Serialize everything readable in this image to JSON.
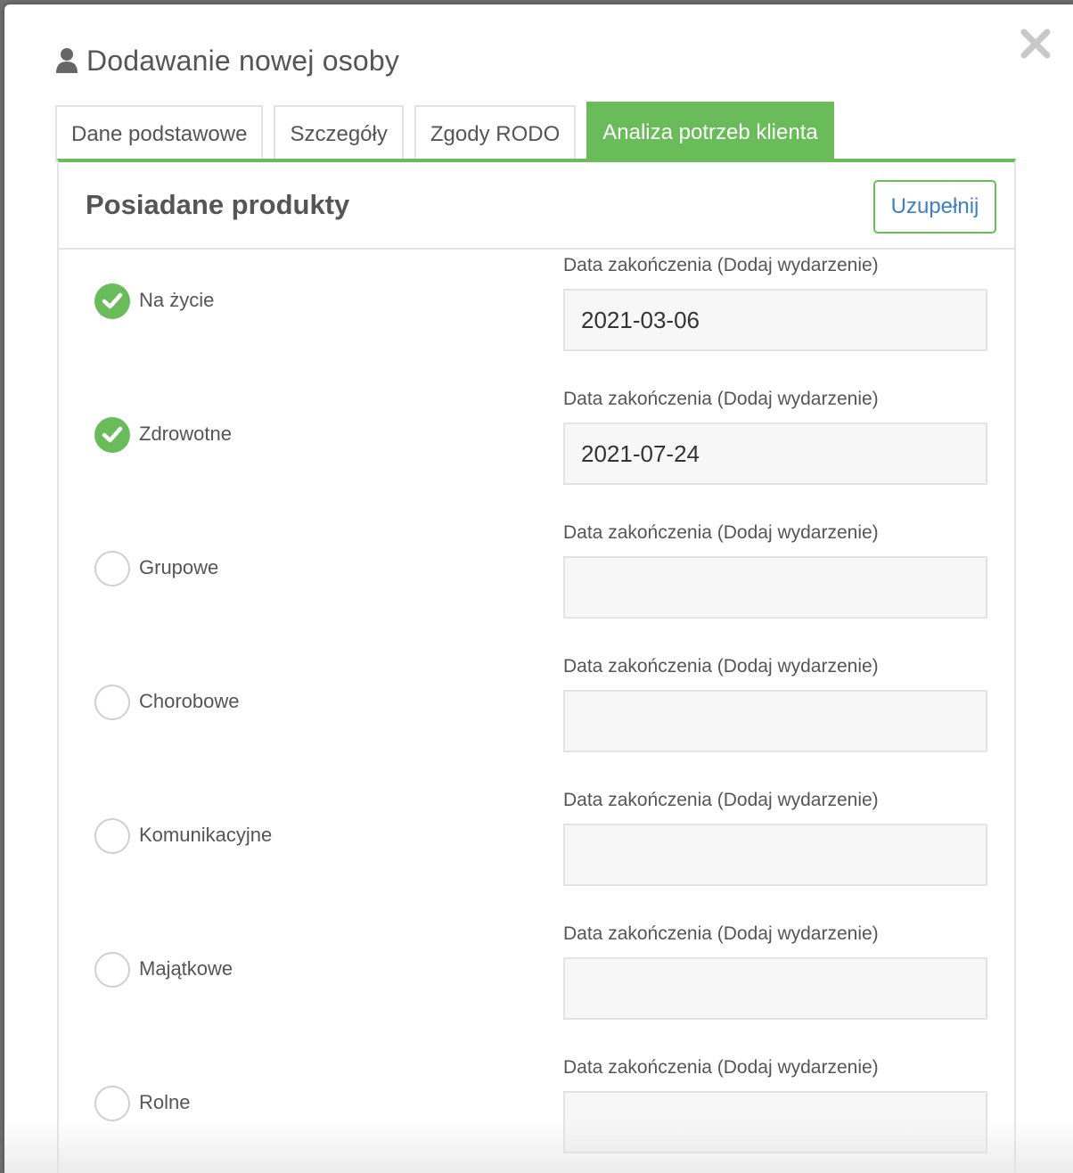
{
  "modal": {
    "title": "Dodawanie nowej osoby",
    "title_icon": "user-icon",
    "close_icon": "close-icon"
  },
  "tabs": [
    {
      "label": "Dane podstawowe",
      "active": false
    },
    {
      "label": "Szczegóły",
      "active": false
    },
    {
      "label": "Zgody RODO",
      "active": false
    },
    {
      "label": "Analiza potrzeb klienta",
      "active": true
    }
  ],
  "panel": {
    "title": "Posiadane produkty",
    "fill_button": "Uzupełnij"
  },
  "colors": {
    "accent": "#6abc5a",
    "link": "#3b7fc4",
    "text": "#555555"
  },
  "products": [
    {
      "label": "Na życie",
      "checked": true,
      "date_label": "Data zakończenia (Dodaj wydarzenie)",
      "date_value": "2021-03-06"
    },
    {
      "label": "Zdrowotne",
      "checked": true,
      "date_label": "Data zakończenia (Dodaj wydarzenie)",
      "date_value": "2021-07-24"
    },
    {
      "label": "Grupowe",
      "checked": false,
      "date_label": "Data zakończenia (Dodaj wydarzenie)",
      "date_value": ""
    },
    {
      "label": "Chorobowe",
      "checked": false,
      "date_label": "Data zakończenia (Dodaj wydarzenie)",
      "date_value": ""
    },
    {
      "label": "Komunikacyjne",
      "checked": false,
      "date_label": "Data zakończenia (Dodaj wydarzenie)",
      "date_value": ""
    },
    {
      "label": "Majątkowe",
      "checked": false,
      "date_label": "Data zakończenia (Dodaj wydarzenie)",
      "date_value": ""
    },
    {
      "label": "Rolne",
      "checked": false,
      "date_label": "Data zakończenia (Dodaj wydarzenie)",
      "date_value": ""
    }
  ]
}
